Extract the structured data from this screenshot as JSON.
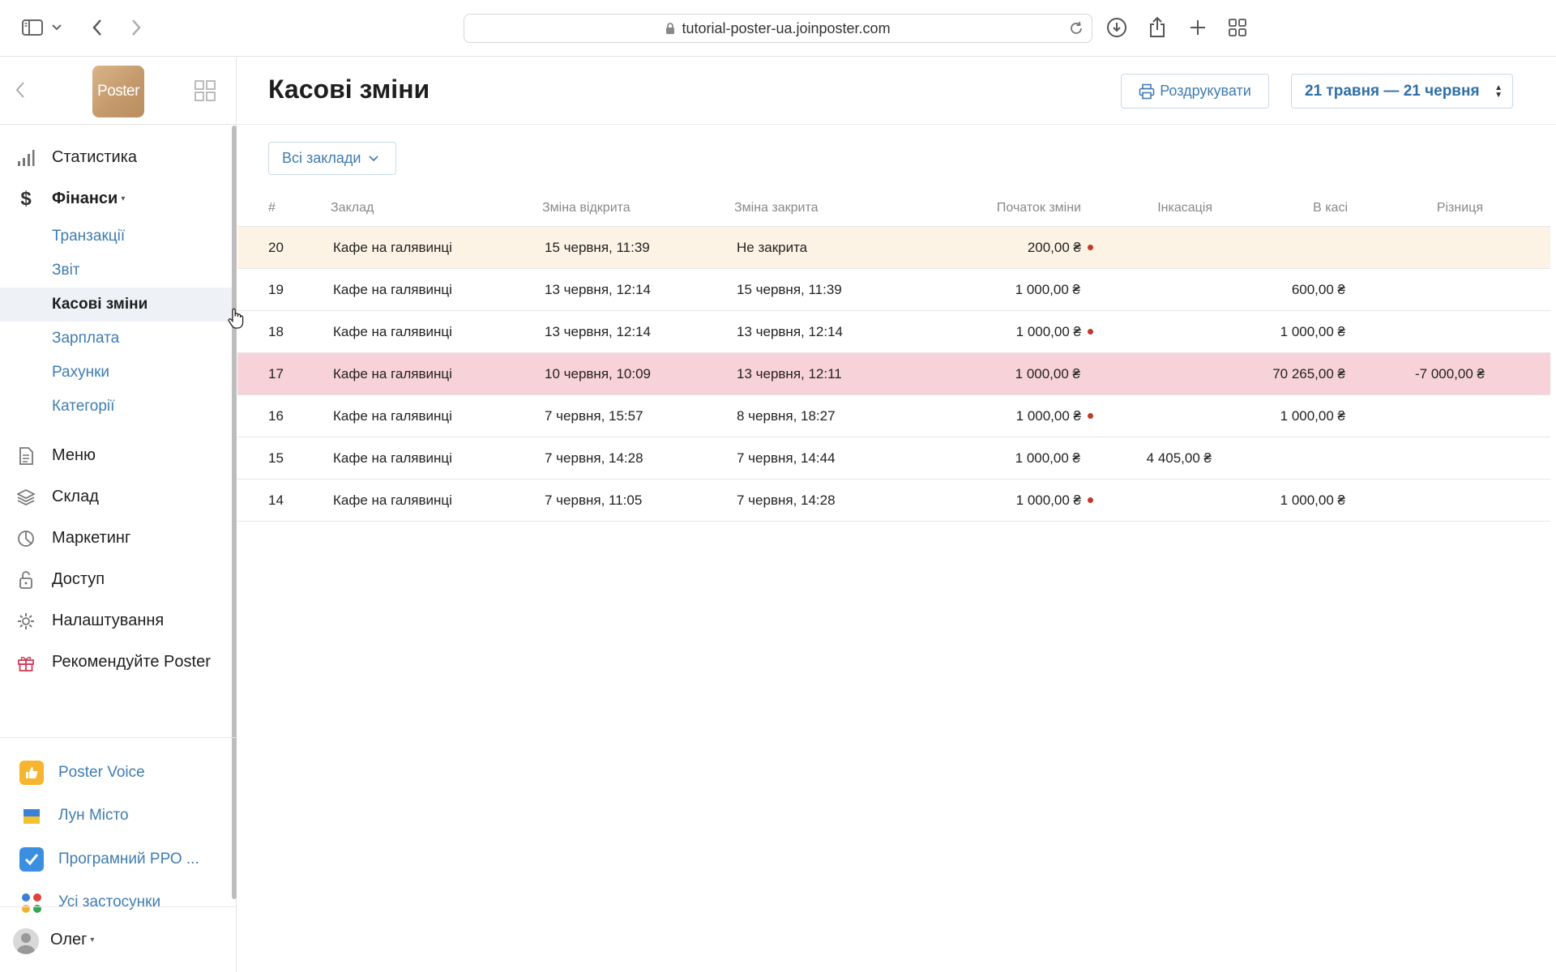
{
  "browser": {
    "url": "tutorial-poster-ua.joinposter.com"
  },
  "sidebar": {
    "logo_text": "Poster",
    "nav": [
      {
        "label": "Статистика",
        "icon": "bar-chart-icon"
      },
      {
        "label": "Фінанси",
        "icon": "dollar-icon",
        "caret": "▾"
      }
    ],
    "finance_sub": [
      {
        "label": "Транзакції"
      },
      {
        "label": "Звіт"
      },
      {
        "label": "Касові зміни",
        "active": true
      },
      {
        "label": "Зарплата"
      },
      {
        "label": "Рахунки"
      },
      {
        "label": "Категорії"
      }
    ],
    "nav2": [
      {
        "label": "Меню",
        "icon": "document-icon"
      },
      {
        "label": "Склад",
        "icon": "layers-icon"
      },
      {
        "label": "Маркетинг",
        "icon": "pie-icon"
      },
      {
        "label": "Доступ",
        "icon": "lock-icon"
      },
      {
        "label": "Налаштування",
        "icon": "gear-icon"
      },
      {
        "label": "Рекомендуйте Poster",
        "icon": "gift-icon"
      }
    ],
    "apps": [
      {
        "label": "Poster Voice",
        "icon": "thumbs-up-icon"
      },
      {
        "label": "Лун Місто",
        "icon": "flag-icon"
      },
      {
        "label": "Програмний РРО ...",
        "icon": "checkbox-icon"
      },
      {
        "label": "Усі застосунки",
        "icon": "apps-icon"
      }
    ],
    "user": {
      "name": "Олег",
      "caret": "▾"
    }
  },
  "page": {
    "title": "Касові зміни",
    "print_button": "Роздрукувати",
    "date_range": "21 травня — 21 червня",
    "filter": "Всі заклади"
  },
  "table": {
    "headers": {
      "id": "#",
      "place": "Заклад",
      "opened": "Зміна відкрита",
      "closed": "Зміна закрита",
      "start": "Початок зміни",
      "collection": "Інкасація",
      "in_cash": "В касі",
      "diff": "Різниця"
    },
    "rows": [
      {
        "id": "20",
        "place": "Кафе на галявинці",
        "opened": "15 червня, 11:39",
        "closed": "Не закрита",
        "start": "200,00 ₴",
        "dot": true,
        "collection": "",
        "in_cash": "",
        "diff": "",
        "state": "warn"
      },
      {
        "id": "19",
        "place": "Кафе на галявинці",
        "opened": "13 червня, 12:14",
        "closed": "15 червня, 11:39",
        "start": "1 000,00 ₴",
        "dot": false,
        "collection": "",
        "in_cash": "600,00 ₴",
        "diff": "",
        "state": ""
      },
      {
        "id": "18",
        "place": "Кафе на галявинці",
        "opened": "13 червня, 12:14",
        "closed": "13 червня, 12:14",
        "start": "1 000,00 ₴",
        "dot": true,
        "collection": "",
        "in_cash": "1 000,00 ₴",
        "diff": "",
        "state": ""
      },
      {
        "id": "17",
        "place": "Кафе на галявинці",
        "opened": "10 червня, 10:09",
        "closed": "13 червня, 12:11",
        "start": "1 000,00 ₴",
        "dot": false,
        "collection": "",
        "in_cash": "70 265,00 ₴",
        "diff": "-7 000,00 ₴",
        "state": "err"
      },
      {
        "id": "16",
        "place": "Кафе на галявинці",
        "opened": "7 червня, 15:57",
        "closed": "8 червня, 18:27",
        "start": "1 000,00 ₴",
        "dot": true,
        "collection": "",
        "in_cash": "1 000,00 ₴",
        "diff": "",
        "state": ""
      },
      {
        "id": "15",
        "place": "Кафе на галявинці",
        "opened": "7 червня, 14:28",
        "closed": "7 червня, 14:44",
        "start": "1 000,00 ₴",
        "dot": false,
        "collection": "4 405,00 ₴",
        "in_cash": "",
        "diff": "",
        "state": ""
      },
      {
        "id": "14",
        "place": "Кафе на галявинці",
        "opened": "7 червня, 11:05",
        "closed": "7 червня, 14:28",
        "start": "1 000,00 ₴",
        "dot": true,
        "collection": "",
        "in_cash": "1 000,00 ₴",
        "diff": "",
        "state": ""
      }
    ]
  },
  "colors": {
    "accent": "#3f7cb0",
    "warn_row": "#fdf3e5",
    "error_row": "#f7d2d8",
    "status_dot": "#c0392b"
  }
}
